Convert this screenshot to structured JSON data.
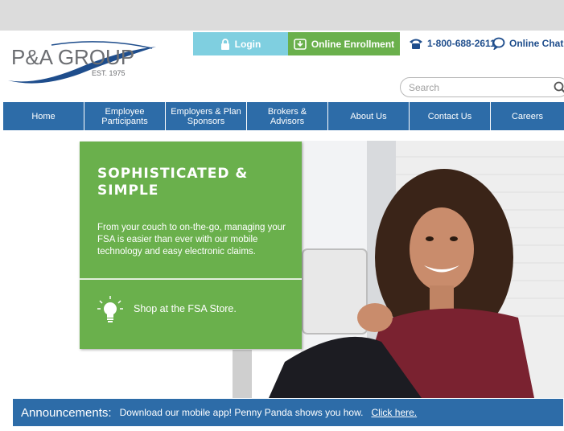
{
  "brand": {
    "logo_text": "P&A GROUP",
    "est": "EST. 1975",
    "primary_color": "#2d6ca8",
    "green_color": "#6ab04c",
    "login_color": "#7fcfe0"
  },
  "header": {
    "login_label": "Login",
    "enroll_label": "Online Enrollment",
    "phone": "1-800-688-2611",
    "chat_label": "Online Chat"
  },
  "search": {
    "placeholder": "Search"
  },
  "nav": {
    "items": [
      {
        "label": "Home"
      },
      {
        "label": "Employee Participants"
      },
      {
        "label": "Employers & Plan Sponsors"
      },
      {
        "label": "Brokers & Advisors"
      },
      {
        "label": "About Us"
      },
      {
        "label": "Contact Us"
      },
      {
        "label": "Careers"
      }
    ]
  },
  "hero": {
    "title": "SOPHISTICATED & SIMPLE",
    "body": "From your couch to on-the-go, managing your FSA is easier than ever with our mobile technology and easy electronic claims.",
    "cta": "Shop at the FSA Store."
  },
  "announcements": {
    "label": "Announcements:",
    "text": "Download our mobile app! Penny Panda shows you how.",
    "link": "Click here."
  }
}
